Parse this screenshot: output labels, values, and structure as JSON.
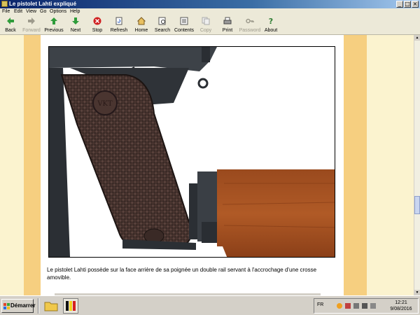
{
  "window": {
    "title": "Le pistolet Lahti expliqué"
  },
  "menu": [
    "File",
    "Edit",
    "View",
    "Go",
    "Options",
    "Help"
  ],
  "toolbar": {
    "back": "Back",
    "forward": "Forward",
    "previous": "Previous",
    "next": "Next",
    "stop": "Stop",
    "refresh": "Refresh",
    "home": "Home",
    "search": "Search",
    "contents": "Contents",
    "copy": "Copy",
    "print": "Print",
    "password": "Password",
    "about": "About"
  },
  "page": {
    "caption": "Le pistolet Lahti possède sur la face arrière de sa poignée un double rail servant à l'accrochage d'une crosse amovible.",
    "grip_emblem": "VKT"
  },
  "taskbar": {
    "start_label": "Démarrer",
    "language": "FR",
    "time": "12:21",
    "date": "9/08/2016"
  },
  "colors": {
    "side_band": "#f6cf80",
    "page_bg": "#fbf3cf",
    "title_bar": "#0a246a"
  }
}
